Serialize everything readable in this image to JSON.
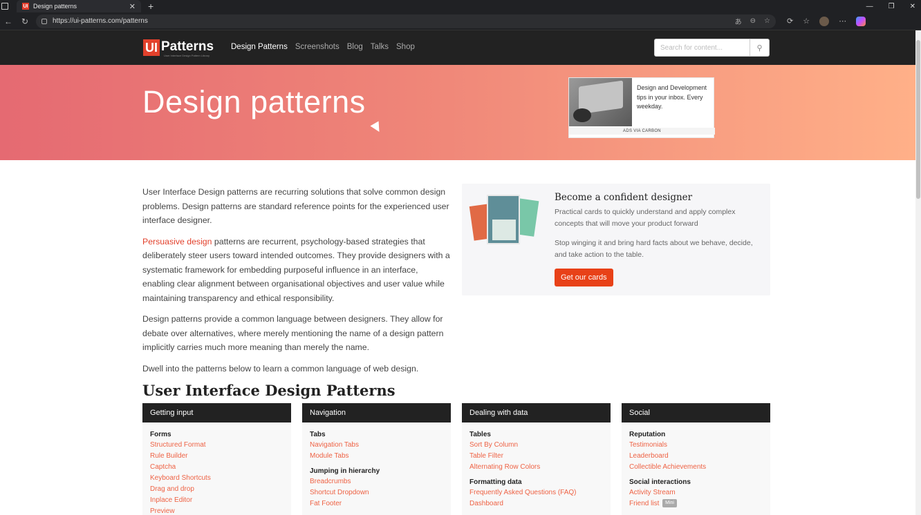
{
  "browser": {
    "tab_title": "Design patterns",
    "tab_favicon": "UI",
    "url": "https://ui-patterns.com/patterns"
  },
  "site": {
    "logo_ui": "UI",
    "logo_patterns": "Patterns",
    "logo_tagline": "User Interface Design Pattern Library",
    "nav": [
      "Design Patterns",
      "Screenshots",
      "Blog",
      "Talks",
      "Shop"
    ],
    "search_placeholder": "Search for content..."
  },
  "hero": {
    "title": "Design patterns",
    "ad_text": "Design and Development tips in your inbox. Every weekday.",
    "ad_via": "ADS VIA CARBON"
  },
  "intro": {
    "p1": "User Interface Design patterns are recurring solutions that solve common design problems. Design patterns are standard reference points for the experienced user interface designer.",
    "p2_link": "Persuasive design",
    "p2_rest": " patterns are recurrent, psychology-based strategies that deliberately steer users toward intended outcomes. They provide designers with a systematic framework for embedding purposeful influence in an interface, enabling clear alignment between organisational objectives and user value while maintaining transparency and ethical responsibility.",
    "p3": "Design patterns provide a common language between designers. They allow for debate over alternatives, where merely mentioning the name of a design pattern implicitly carries much more meaning than merely the name.",
    "p4": "Dwell into the patterns below to learn a common language of web design."
  },
  "promo": {
    "title": "Become a confident designer",
    "desc": "Practical cards to quickly understand and apply complex concepts that will move your product forward",
    "desc2": "Stop winging it and bring hard facts about we behave, decide, and take action to the table.",
    "button": "Get our cards"
  },
  "section_title": "User Interface Design Patterns",
  "categories": [
    {
      "title": "Getting input",
      "groups": [
        {
          "name": "Forms",
          "links": [
            "Structured Format",
            "Rule Builder",
            "Captcha",
            "Keyboard Shortcuts",
            "Drag and drop",
            "Inplace Editor",
            "Preview"
          ]
        }
      ]
    },
    {
      "title": "Navigation",
      "groups": [
        {
          "name": "Tabs",
          "links": [
            "Navigation Tabs",
            "Module Tabs"
          ]
        },
        {
          "name": "Jumping in hierarchy",
          "links": [
            "Breadcrumbs",
            "Shortcut Dropdown",
            "Fat Footer"
          ]
        }
      ]
    },
    {
      "title": "Dealing with data",
      "groups": [
        {
          "name": "Tables",
          "links": [
            "Sort By Column",
            "Table Filter",
            "Alternating Row Colors"
          ]
        },
        {
          "name": "Formatting data",
          "links": [
            "Frequently Asked Questions (FAQ)",
            "Dashboard"
          ]
        }
      ]
    },
    {
      "title": "Social",
      "groups": [
        {
          "name": "Reputation",
          "links": [
            "Testimonials",
            "Leaderboard",
            "Collectible Achievements"
          ]
        },
        {
          "name": "Social interactions",
          "links": [
            "Activity Stream",
            "Friend list"
          ]
        }
      ],
      "badge": "Mini"
    }
  ]
}
